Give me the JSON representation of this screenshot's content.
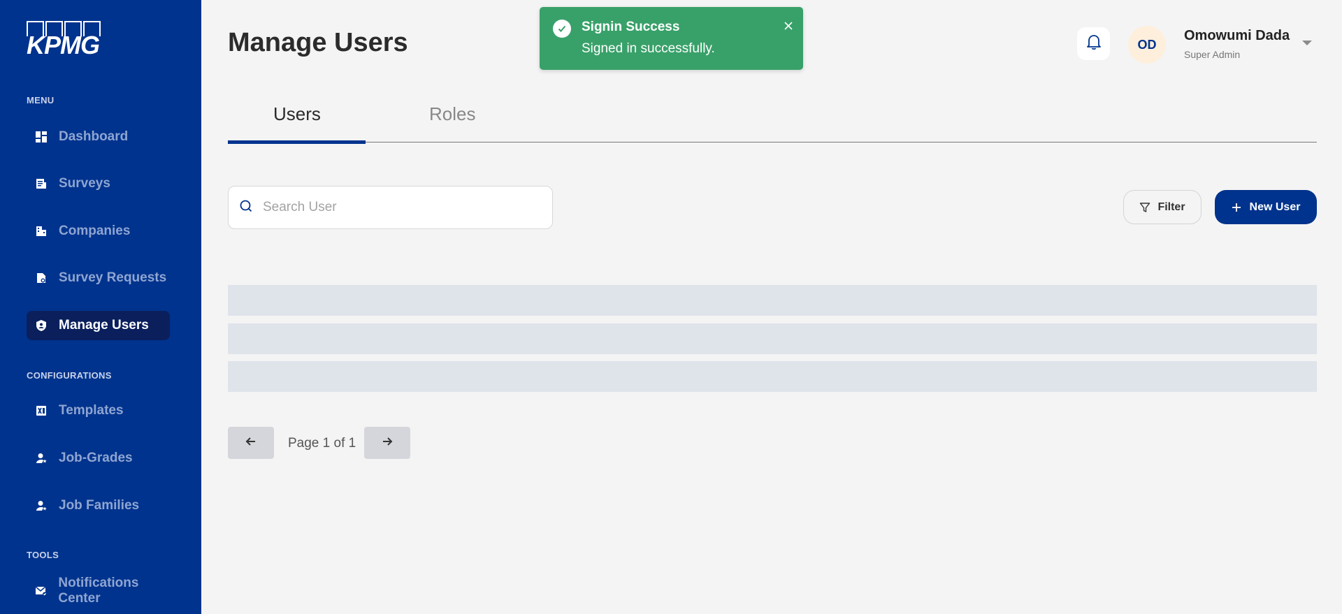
{
  "brand": {
    "logo_text": "KPMG"
  },
  "sidebar": {
    "sections": {
      "menu": "MENU",
      "configurations": "CONFIGURATIONS",
      "tools": "TOOLS"
    },
    "items": [
      {
        "label": "Dashboard",
        "icon": "dashboard-icon"
      },
      {
        "label": "Surveys",
        "icon": "survey-icon"
      },
      {
        "label": "Companies",
        "icon": "building-icon"
      },
      {
        "label": "Survey Requests",
        "icon": "request-icon"
      },
      {
        "label": "Manage Users",
        "icon": "shield-user-icon",
        "active": true
      },
      {
        "label": "Templates",
        "icon": "excel-icon"
      },
      {
        "label": "Job-Grades",
        "icon": "user-star-icon"
      },
      {
        "label": "Job Families",
        "icon": "user-star-icon"
      },
      {
        "label": "Notifications Center",
        "icon": "mail-check-icon"
      }
    ]
  },
  "page": {
    "title": "Manage Users"
  },
  "tabs": [
    {
      "label": "Users",
      "active": true
    },
    {
      "label": "Roles",
      "active": false
    }
  ],
  "search": {
    "placeholder": "Search User",
    "value": ""
  },
  "actions": {
    "filter_label": "Filter",
    "new_user_label": "New User"
  },
  "pagination": {
    "text": "Page 1 of 1",
    "current": 1,
    "total": 1
  },
  "user": {
    "initials": "OD",
    "name": "Omowumi Dada",
    "role": "Super Admin"
  },
  "toast": {
    "title": "Signin Success",
    "message": "Signed in successfully.",
    "color": "#38a169"
  },
  "colors": {
    "brand": "#00338d",
    "active_nav": "#0a1f5c",
    "skeleton": "#dfe3ea"
  }
}
